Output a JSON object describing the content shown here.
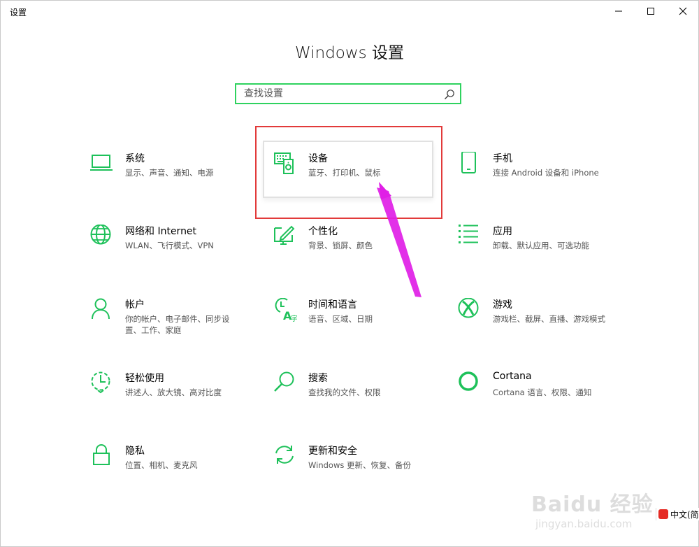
{
  "window": {
    "title": "设置"
  },
  "header": {
    "title": "Windows 设置"
  },
  "search": {
    "placeholder": "查找设置"
  },
  "items": [
    {
      "name": "系统",
      "desc": "显示、声音、通知、电源",
      "icon": "laptop-icon"
    },
    {
      "name": "设备",
      "desc": "蓝牙、打印机、鼠标",
      "icon": "keyboard-speaker-icon"
    },
    {
      "name": "手机",
      "desc": "连接 Android 设备和 iPhone",
      "icon": "phone-icon"
    },
    {
      "name": "网络和 Internet",
      "desc": "WLAN、飞行模式、VPN",
      "icon": "globe-icon"
    },
    {
      "name": "个性化",
      "desc": "背景、锁屏、颜色",
      "icon": "paint-monitor-icon"
    },
    {
      "name": "应用",
      "desc": "卸载、默认应用、可选功能",
      "icon": "app-list-icon"
    },
    {
      "name": "帐户",
      "desc": "你的帐户、电子邮件、同步设置、工作、家庭",
      "icon": "person-icon"
    },
    {
      "name": "时间和语言",
      "desc": "语音、区域、日期",
      "icon": "time-language-icon"
    },
    {
      "name": "游戏",
      "desc": "游戏栏、截屏、直播、游戏模式",
      "icon": "xbox-icon"
    },
    {
      "name": "轻松使用",
      "desc": "讲述人、放大镜、高对比度",
      "icon": "ease-of-access-icon"
    },
    {
      "name": "搜索",
      "desc": "查找我的文件、权限",
      "icon": "magnifier-icon"
    },
    {
      "name": "Cortana",
      "desc": "Cortana 语言、权限、通知",
      "icon": "cortana-icon"
    },
    {
      "name": "隐私",
      "desc": "位置、相机、麦克风",
      "icon": "lock-icon"
    },
    {
      "name": "更新和安全",
      "desc": "Windows 更新、恢复、备份",
      "icon": "sync-icon"
    }
  ],
  "watermark": {
    "brand": "Baidu 经验",
    "url": "jingyan.baidu.com"
  },
  "ime": {
    "label": "中文(简"
  },
  "colors": {
    "accent": "#1ec15a",
    "highlight": "#e23a3a",
    "arrow": "#e01ee6",
    "search_border": "#2fd25f"
  }
}
